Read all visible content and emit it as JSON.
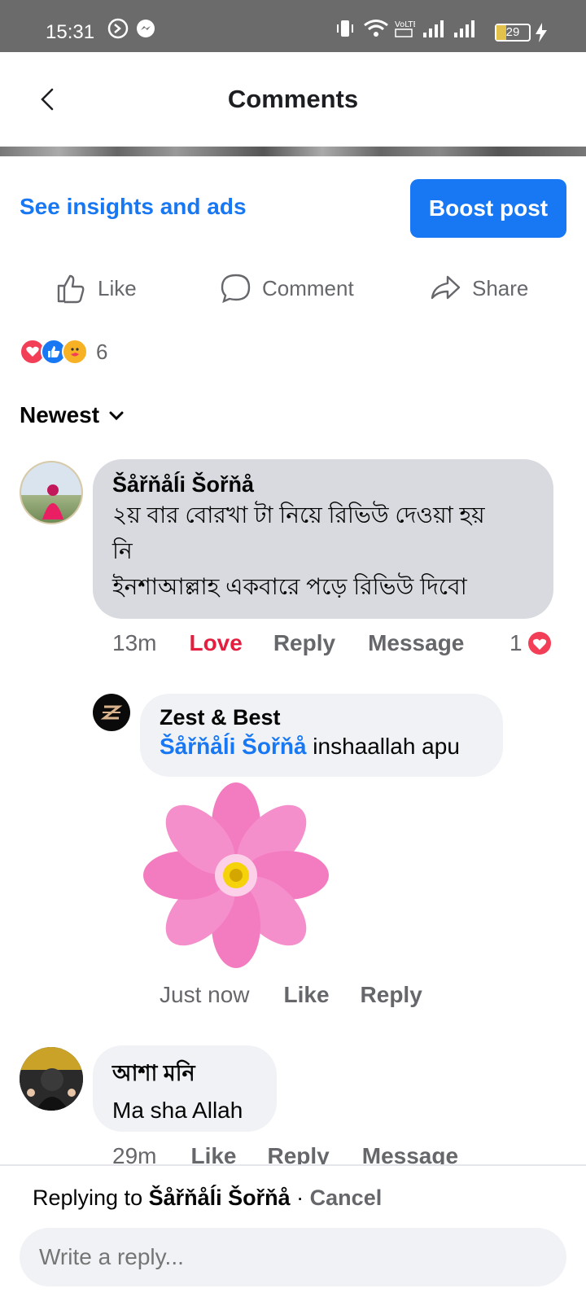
{
  "status_bar": {
    "time": "15:31",
    "battery": "29"
  },
  "header": {
    "title": "Comments"
  },
  "post_tools": {
    "insights_link": "See insights and ads",
    "boost_button": "Boost post"
  },
  "actions": {
    "like": "Like",
    "comment": "Comment",
    "share": "Share"
  },
  "reactions": {
    "count": "6",
    "icons": [
      "love-reaction-icon",
      "like-reaction-icon",
      "care-reaction-icon"
    ]
  },
  "sort": {
    "label": "Newest"
  },
  "comments": [
    {
      "author": "Šåřňåĺi Šořňå",
      "text_line1": "২য় বার বোরখা টা নিয়ে রিভিউ দেওয়া হয়",
      "text_line2": "নি",
      "text_line3": "ইনশাআল্লাহ একবারে পড়ে রিভিউ দিবো",
      "time": "13m",
      "love_label": "Love",
      "reply_label": "Reply",
      "message_label": "Message",
      "reaction_count": "1"
    },
    {
      "author": "Zest & Best",
      "mention": "Šåřňåĺi Šořňå",
      "text": "inshaallah apu",
      "time": "Just now",
      "like_label": "Like",
      "reply_label": "Reply"
    },
    {
      "author": "আশা মনি",
      "text": "Ma sha Allah",
      "time": "29m",
      "like_label": "Like",
      "reply_label": "Reply",
      "message_label": "Message"
    }
  ],
  "reply_bar": {
    "prefix": "Replying to ",
    "target": "Šåřňåĺi Šořňå",
    "separator": " · ",
    "cancel": "Cancel",
    "placeholder": "Write a reply..."
  },
  "colors": {
    "accent": "#1877f2",
    "love": "#e41e3f",
    "bubble": "#f0f2f5",
    "bubble_active": "#d8dadf",
    "meta": "#65676b"
  }
}
